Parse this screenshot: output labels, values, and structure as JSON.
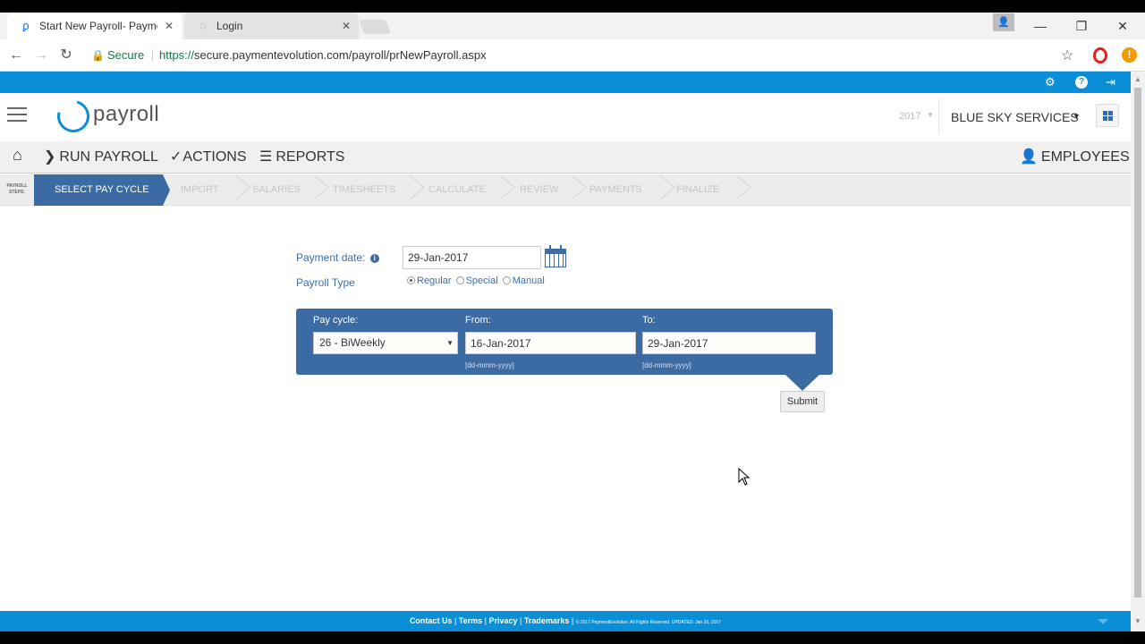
{
  "browser": {
    "tabs": [
      {
        "title": "Start New Payroll- Payme",
        "close": "✕"
      },
      {
        "title": "Login",
        "close": "✕"
      }
    ],
    "window_controls": {
      "minimize": "—",
      "restore": "❐",
      "close": "✕"
    },
    "secure_label": "Secure",
    "url_scheme": "https://",
    "url_host": "secure.paymentevolution.com",
    "url_path": "/payroll/prNewPayroll.aspx"
  },
  "header": {
    "logo_text": "payroll",
    "year": "2017",
    "company": "BLUE SKY SERVICES"
  },
  "menu": {
    "run_payroll": "RUN PAYROLL",
    "actions": "ACTIONS",
    "reports": "REPORTS",
    "employees": "EMPLOYEES"
  },
  "steps": {
    "label_line1": "PAYROLL",
    "label_line2": "STEPS:",
    "items": [
      {
        "label": "SELECT PAY CYCLE",
        "active": true
      },
      {
        "label": "IMPORT",
        "active": false
      },
      {
        "label": "SALARIES",
        "active": false
      },
      {
        "label": "TIMESHEETS",
        "active": false
      },
      {
        "label": "CALCULATE",
        "active": false
      },
      {
        "label": "REVIEW",
        "active": false
      },
      {
        "label": "PAYMENTS",
        "active": false
      },
      {
        "label": "FINALIZE",
        "active": false
      }
    ]
  },
  "form": {
    "payment_date_label": "Payment date:",
    "payment_date_value": "29-Jan-2017",
    "payroll_type_label": "Payroll Type",
    "payroll_types": [
      "Regular",
      "Special",
      "Manual"
    ],
    "payroll_type_selected": "Regular",
    "pay_cycle_label": "Pay cycle:",
    "pay_cycle_value": "26 - BiWeekly",
    "from_label": "From:",
    "from_value": "16-Jan-2017",
    "to_label": "To:",
    "to_value": "29-Jan-2017",
    "date_hint": "[dd-mmm-yyyy]",
    "submit_label": "Submit"
  },
  "footer": {
    "links": [
      "Contact Us",
      "Terms",
      "Privacy",
      "Trademarks"
    ],
    "copyright": "© 2017 PaymentEvolution. All Rights Reserved. UPDATED: Jan 10, 2017"
  },
  "colors": {
    "brand_blue": "#0a8fd6",
    "panel_blue": "#3c6aa3",
    "label_blue": "#3b6ea8"
  }
}
